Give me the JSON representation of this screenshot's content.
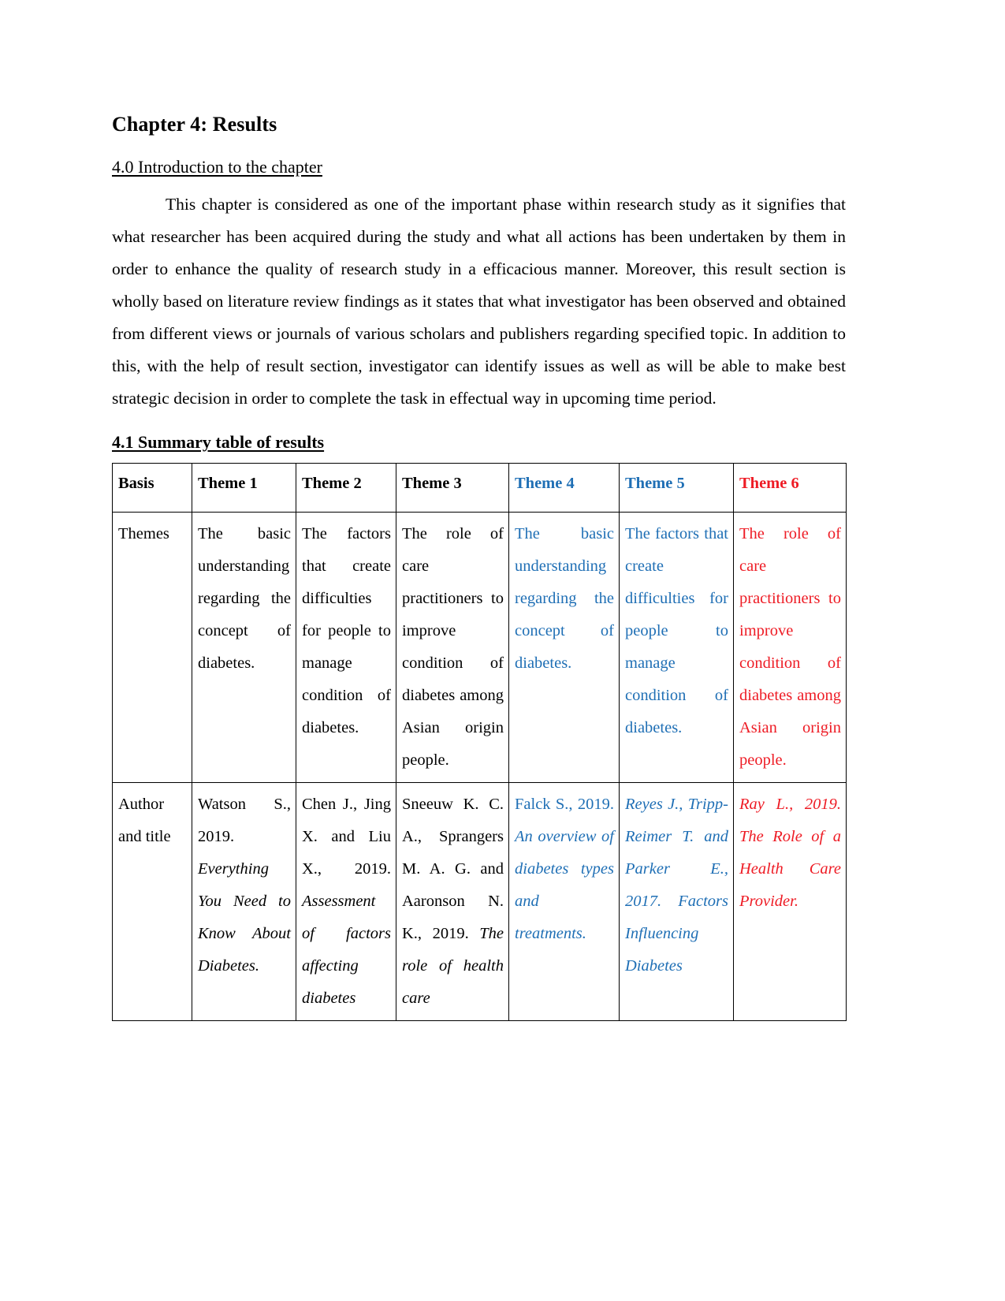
{
  "document": {
    "chapter_title": "Chapter 4: Results",
    "section_4_0_heading": "4.0 Introduction to the chapter",
    "intro_paragraph": "This chapter is considered as one of the important phase within research study as it signifies that what researcher has been acquired during the study and what all actions has been undertaken by them in order to enhance the quality of research study in a efficacious manner. Moreover, this result section is wholly based on literature review findings as it states that what investigator has been observed and obtained from different views or journals of various scholars and publishers regarding specified topic. In addition to this, with the help of result section, investigator can identify issues as well as will be able to make best strategic decision in order to complete the task in effectual way in upcoming time period.",
    "section_4_1_heading": "4.1 Summary table of results"
  },
  "colors": {
    "theme_blue": "#1f6fb5",
    "theme_red": "#ee1c25",
    "text_black": "#000000",
    "table_border": "#000000"
  },
  "table": {
    "headers": [
      {
        "label": "Basis",
        "color": "#000000"
      },
      {
        "label": "Theme 1",
        "color": "#000000"
      },
      {
        "label": "Theme 2",
        "color": "#000000"
      },
      {
        "label": "Theme 3",
        "color": "#000000"
      },
      {
        "label": "Theme 4",
        "color": "#1f6fb5"
      },
      {
        "label": "Theme 5",
        "color": "#1f6fb5"
      },
      {
        "label": "Theme 6",
        "color": "#ee1c25"
      }
    ],
    "rows": [
      {
        "label": "Themes",
        "cells": [
          {
            "text": "The basic understanding regarding the concept of diabetes.",
            "color": "#000000",
            "italic": false
          },
          {
            "text": "The factors that create difficulties for people to manage condition of diabetes.",
            "color": "#000000",
            "italic": false
          },
          {
            "text": "The role of care practitioners to improve condition of diabetes among Asian origin people.",
            "color": "#000000",
            "italic": false
          },
          {
            "text": "The basic understanding regarding the concept of diabetes.",
            "color": "#1f6fb5",
            "italic": false
          },
          {
            "text": "The factors that create difficulties for people to manage condition of diabetes.",
            "color": "#1f6fb5",
            "italic": false
          },
          {
            "text": "The role of care practitioners to improve condition of diabetes among Asian origin people.",
            "color": "#ee1c25",
            "italic": false
          }
        ]
      },
      {
        "label": "Author and title",
        "cells": [
          {
            "roman": "Watson S., 2019. ",
            "italic_text": "Everything You Need to Know About Diabetes.",
            "color": "#000000"
          },
          {
            "roman": "Chen J., Jing X. and Liu X., 2019. ",
            "italic_text": "Assessment of factors affecting diabetes",
            "color": "#000000"
          },
          {
            "roman": "Sneeuw K. C. A., Sprangers M. A. G. and Aaronson N. K., 2019. ",
            "italic_text": "The role of health care",
            "color": "#000000"
          },
          {
            "roman": "Falck S., 2019. ",
            "italic_text": "An overview of diabetes types and treatments.",
            "color": "#1f6fb5"
          },
          {
            "roman": "",
            "italic_text": "Reyes J., Tripp-Reimer T. and Parker E., 2017. Factors Influencing Diabetes",
            "color": "#1f6fb5"
          },
          {
            "roman": "",
            "italic_text": "Ray L., 2019. The Role of a Health Care Provider.",
            "color": "#ee1c25"
          }
        ]
      }
    ]
  }
}
